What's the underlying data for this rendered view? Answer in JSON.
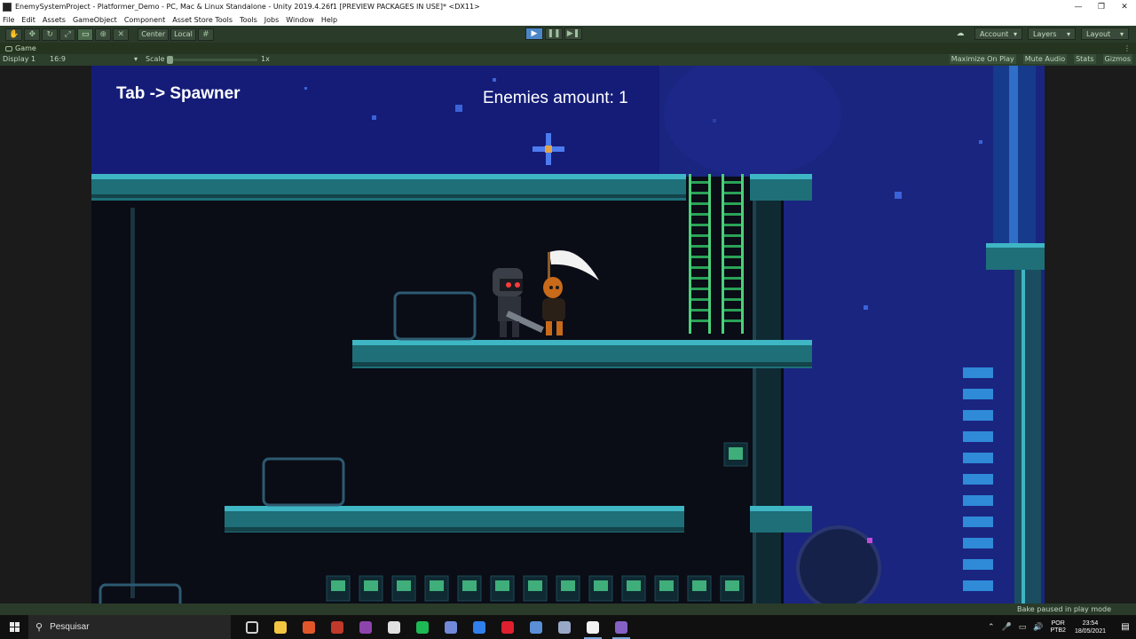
{
  "window": {
    "title": "EnemySystemProject - Platformer_Demo - PC, Mac & Linux Standalone - Unity 2019.4.26f1 [PREVIEW PACKAGES IN USE]* <DX11>",
    "minimize": "—",
    "maximize": "❐",
    "close": "✕"
  },
  "menu": [
    "File",
    "Edit",
    "Assets",
    "GameObject",
    "Component",
    "Asset Store Tools",
    "Tools",
    "Jobs",
    "Window",
    "Help"
  ],
  "toolbar": {
    "tools": [
      "hand-tool",
      "move-tool",
      "rotate-tool",
      "scale-tool",
      "rect-tool",
      "transform-tool",
      "custom-tool"
    ],
    "active_tool": "rect-tool",
    "pivot_center": "Center",
    "pivot_local": "Local",
    "account": "Account",
    "layers": "Layers",
    "layout": "Layout"
  },
  "game_view": {
    "tab": "Game",
    "display": "Display 1",
    "aspect": "16:9",
    "scale_label": "Scale",
    "scale_value": "1x",
    "options": [
      "Maximize On Play",
      "Mute Audio",
      "Stats",
      "Gizmos"
    ]
  },
  "hud": {
    "hint": "Tab -> Spawner",
    "enemies": "Enemies amount: 1"
  },
  "status": {
    "message": "Bake paused in play mode"
  },
  "taskbar": {
    "search_placeholder": "Pesquisar",
    "apps": [
      {
        "name": "task-view",
        "color": "#d0d0d0"
      },
      {
        "name": "file-explorer",
        "color": "#f4c542"
      },
      {
        "name": "office",
        "color": "#e2572a"
      },
      {
        "name": "app-red",
        "color": "#c0392b"
      },
      {
        "name": "github-desktop",
        "color": "#8e44ad"
      },
      {
        "name": "unity-hub",
        "color": "#e0e0e0"
      },
      {
        "name": "spotify",
        "color": "#1db954"
      },
      {
        "name": "discord",
        "color": "#7289da"
      },
      {
        "name": "app-blue",
        "color": "#2f80ed"
      },
      {
        "name": "opera",
        "color": "#e0202f"
      },
      {
        "name": "app-store",
        "color": "#5a8fd8"
      },
      {
        "name": "app-chat",
        "color": "#9aa8c8"
      },
      {
        "name": "unity-editor",
        "color": "#f2f2f2"
      },
      {
        "name": "visual-studio",
        "color": "#8661c5"
      }
    ],
    "language": "POR",
    "keyboard": "PTB2",
    "time": "23:54",
    "date": "18/05/2021"
  }
}
